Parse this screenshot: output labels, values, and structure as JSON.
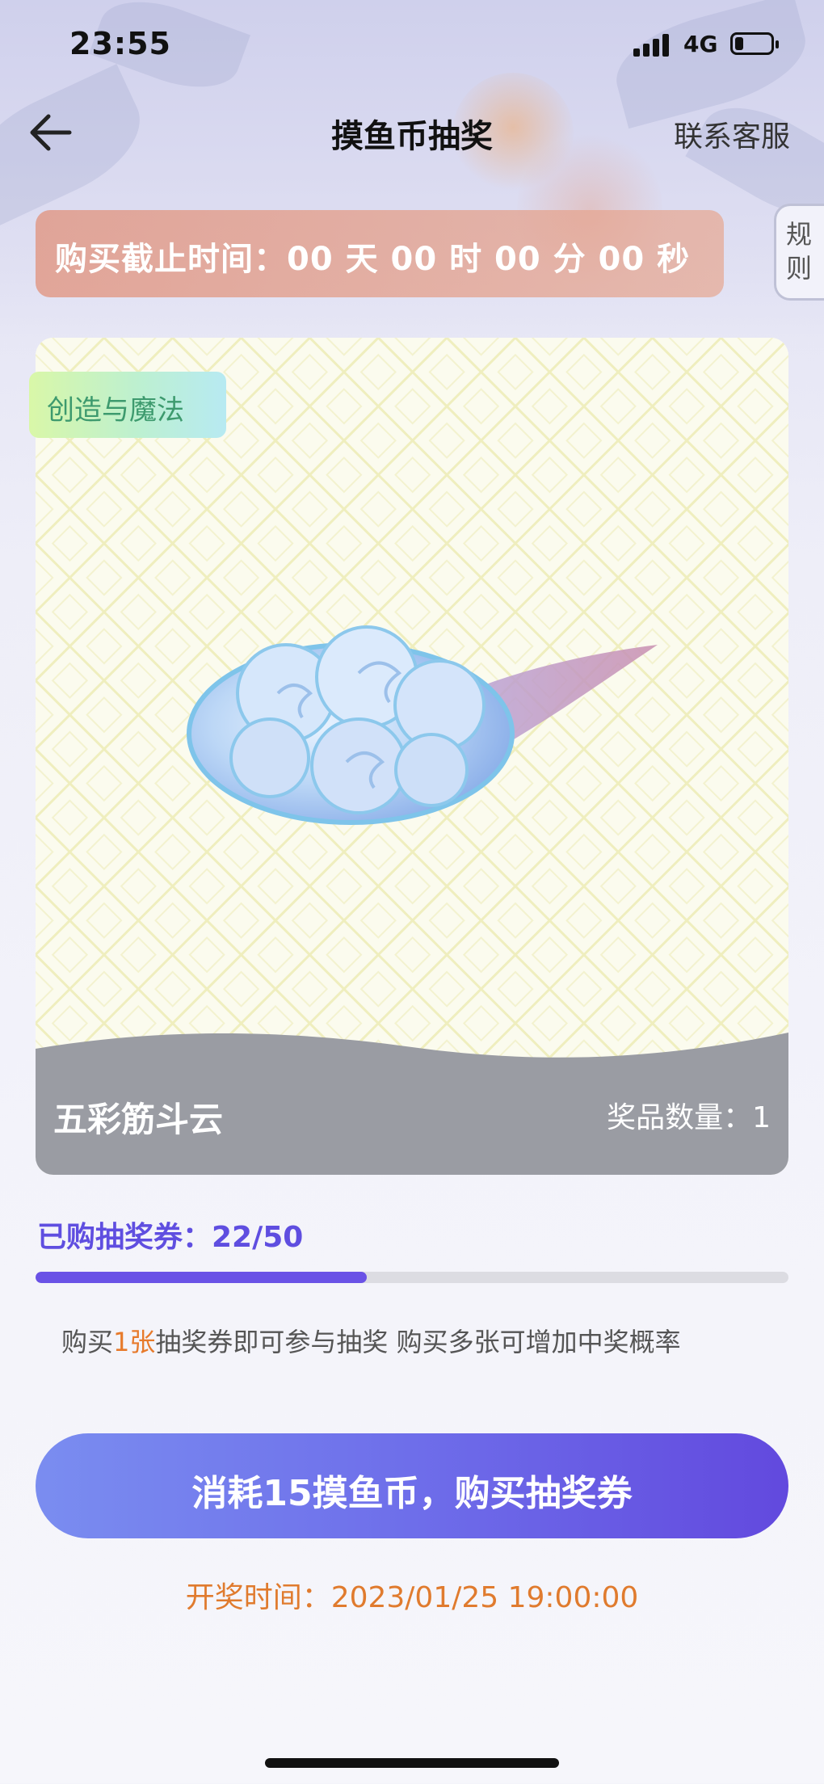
{
  "status_bar": {
    "time": "23:55",
    "network": "4G"
  },
  "header": {
    "title": "摸鱼币抽奖",
    "service_link": "联系客服",
    "back_icon": "arrow-left-icon"
  },
  "countdown": {
    "text": "购买截止时间：00 天 00 时 00 分 00 秒"
  },
  "rules_tab": {
    "line1": "规",
    "line2": "则"
  },
  "prize": {
    "category_tag": "创造与魔法",
    "name": "五彩筋斗云",
    "quantity_text": "奖品数量：1",
    "image": "cloud-illustration"
  },
  "tickets": {
    "label": "已购抽奖券：22/50",
    "purchased": 22,
    "total": 50,
    "progress_fraction": 0.44
  },
  "hint": {
    "prefix": "购买",
    "highlight": "1张",
    "suffix": "抽奖券即可参与抽奖 购买多张可增加中奖概率"
  },
  "buy_button": {
    "label": "消耗15摸鱼币，购买抽奖券"
  },
  "draw_time": {
    "text": "开奖时间：2023/01/25 19:00:00"
  },
  "colors": {
    "accent_purple": "#5f4ee0",
    "button_gradient_start": "#7a8df0",
    "button_gradient_end": "#6249de",
    "highlight_orange": "#e77a2b",
    "countdown_bg": "#e39a84",
    "footer_gray": "#9a9ca3"
  }
}
